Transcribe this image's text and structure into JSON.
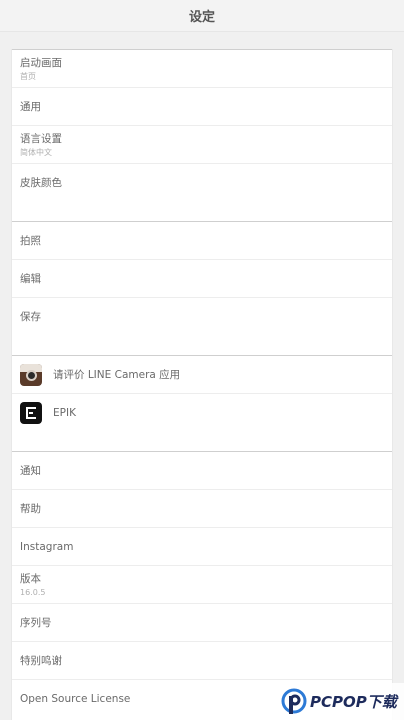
{
  "header": {
    "title": "设定"
  },
  "groups": [
    {
      "rows": [
        {
          "label": "启动画面",
          "sub": "首页"
        },
        {
          "label": "通用"
        },
        {
          "label": "语言设置",
          "sub": "简体中文"
        },
        {
          "label": "皮肤颜色"
        }
      ]
    },
    {
      "rows": [
        {
          "label": "拍照"
        },
        {
          "label": "编辑"
        },
        {
          "label": "保存"
        }
      ]
    },
    {
      "rows": [
        {
          "label": "请评价 LINE Camera 应用",
          "icon": "line-camera-icon"
        },
        {
          "label": "EPIK",
          "icon": "epik-icon"
        }
      ]
    },
    {
      "rows": [
        {
          "label": "通知"
        },
        {
          "label": "帮助"
        },
        {
          "label": "Instagram"
        },
        {
          "label": "版本",
          "sub": "16.0.5"
        },
        {
          "label": "序列号"
        },
        {
          "label": "特别鸣谢"
        },
        {
          "label": "Open Source License"
        }
      ]
    }
  ],
  "watermark": {
    "brand": "PCPOP下载",
    "color_dark": "#1d2b5c",
    "color_blue": "#2d7ad6"
  }
}
